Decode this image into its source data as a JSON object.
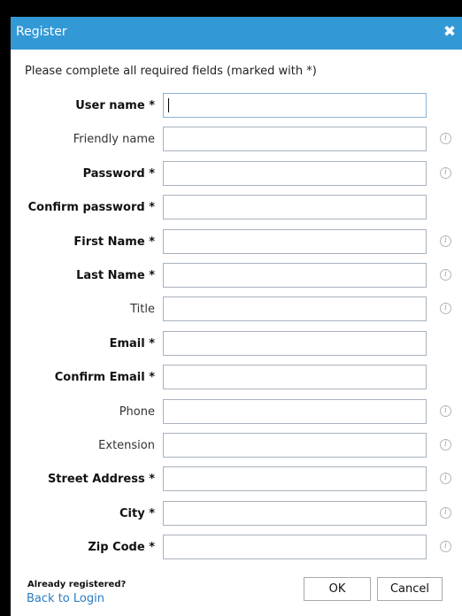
{
  "dialog": {
    "title": "Register",
    "close_glyph": "✖",
    "instruction": "Please complete all required fields (marked with *)"
  },
  "fields": [
    {
      "label": "User name *",
      "required": true,
      "info": false,
      "value": ""
    },
    {
      "label": "Friendly name",
      "required": false,
      "info": true,
      "value": ""
    },
    {
      "label": "Password *",
      "required": true,
      "info": true,
      "value": ""
    },
    {
      "label": "Confirm password *",
      "required": true,
      "info": false,
      "value": ""
    },
    {
      "label": "First Name *",
      "required": true,
      "info": true,
      "value": ""
    },
    {
      "label": "Last Name *",
      "required": true,
      "info": true,
      "value": ""
    },
    {
      "label": "Title",
      "required": false,
      "info": true,
      "value": ""
    },
    {
      "label": "Email *",
      "required": true,
      "info": false,
      "value": ""
    },
    {
      "label": "Confirm Email *",
      "required": true,
      "info": false,
      "value": ""
    },
    {
      "label": "Phone",
      "required": false,
      "info": true,
      "value": ""
    },
    {
      "label": "Extension",
      "required": false,
      "info": true,
      "value": ""
    },
    {
      "label": "Street Address *",
      "required": true,
      "info": true,
      "value": ""
    },
    {
      "label": "City *",
      "required": true,
      "info": true,
      "value": ""
    },
    {
      "label": "Zip Code *",
      "required": true,
      "info": true,
      "value": ""
    }
  ],
  "info_icon": "info-icon",
  "footer": {
    "question": "Already registered?",
    "link": "Back to Login",
    "ok_label": "OK",
    "cancel_label": "Cancel"
  },
  "colors": {
    "titlebar": "#3399d6",
    "link": "#2b7bc4"
  }
}
